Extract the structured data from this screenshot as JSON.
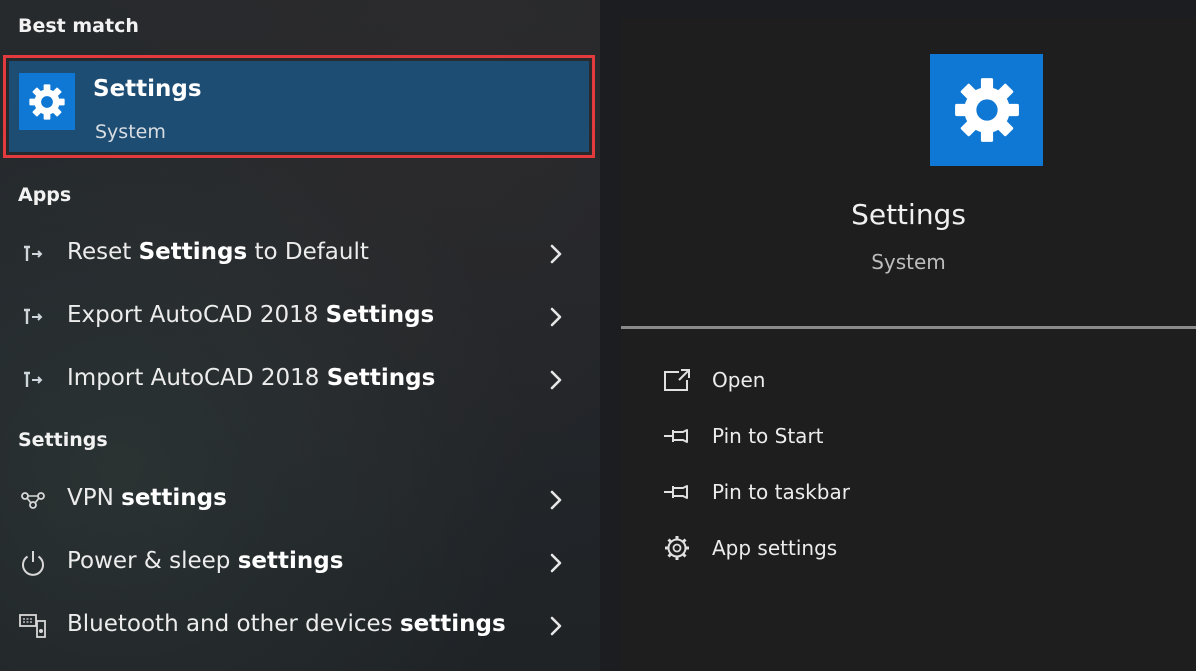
{
  "left": {
    "best_match_heading": "Best match",
    "best_match": {
      "title": "Settings",
      "subtitle": "System",
      "icon": "gear-icon"
    },
    "apps_heading": "Apps",
    "apps": [
      {
        "pre": "Reset ",
        "bold": "Settings",
        "post": " to Default",
        "icon": "app-shortcut-icon"
      },
      {
        "pre": "Export AutoCAD 2018 ",
        "bold": "Settings",
        "post": "",
        "icon": "app-shortcut-icon"
      },
      {
        "pre": "Import AutoCAD 2018 ",
        "bold": "Settings",
        "post": "",
        "icon": "app-shortcut-icon"
      }
    ],
    "settings_heading": "Settings",
    "settings": [
      {
        "pre": "VPN ",
        "bold": "settings",
        "post": "",
        "icon": "vpn-icon"
      },
      {
        "pre": "Power & sleep ",
        "bold": "settings",
        "post": "",
        "icon": "power-icon"
      },
      {
        "pre": "Bluetooth and other devices ",
        "bold": "settings",
        "post": "",
        "icon": "devices-icon"
      }
    ]
  },
  "right": {
    "title": "Settings",
    "subtitle": "System",
    "actions": [
      {
        "label": "Open",
        "icon": "open-icon"
      },
      {
        "label": "Pin to Start",
        "icon": "pin-icon"
      },
      {
        "label": "Pin to taskbar",
        "icon": "pin-icon"
      },
      {
        "label": "App settings",
        "icon": "gear-outline-icon"
      }
    ]
  },
  "colors": {
    "highlight": "#1e4d73",
    "selection_border": "#e33b3d",
    "tile": "#0f78d4"
  }
}
